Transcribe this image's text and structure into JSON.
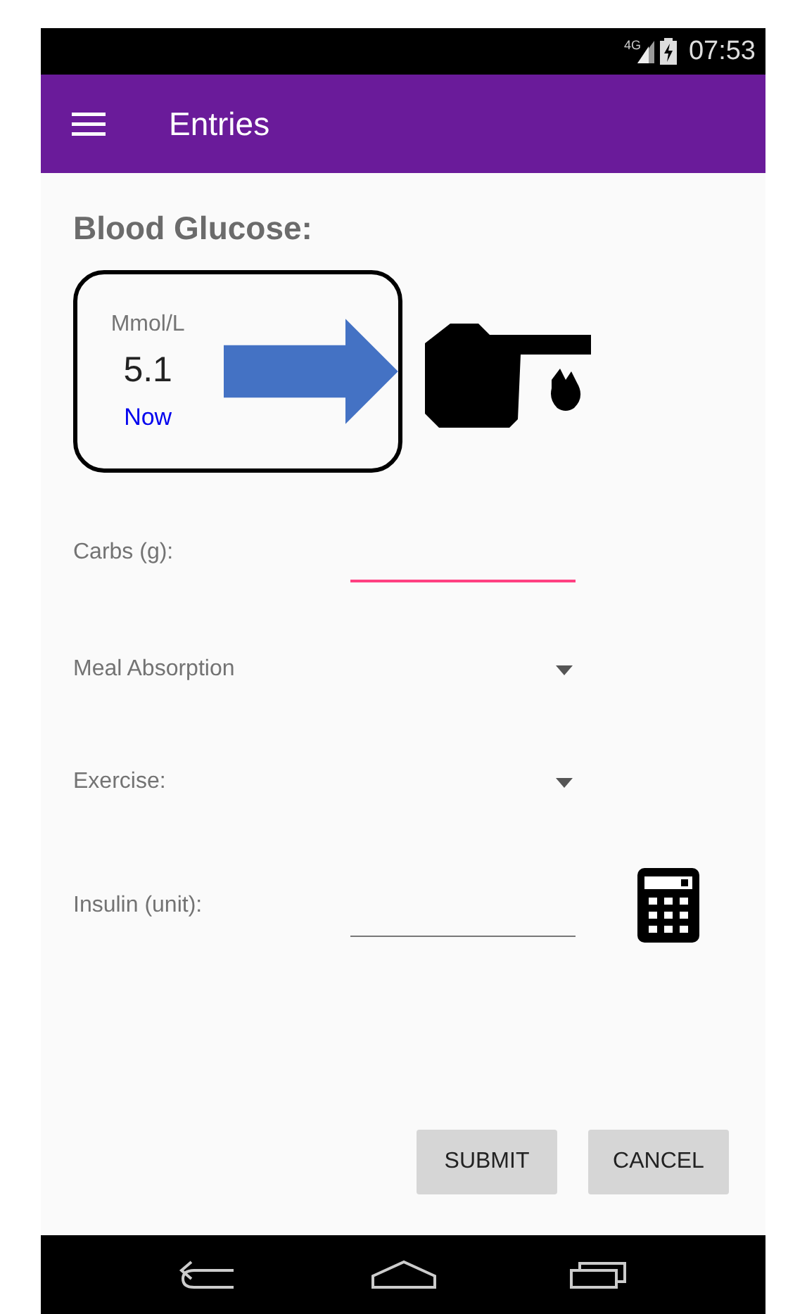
{
  "status_bar": {
    "network": "4G",
    "time": "07:53"
  },
  "app_bar": {
    "title": "Entries"
  },
  "section_title": "Blood Glucose:",
  "glucose": {
    "unit": "Mmol/L",
    "value": "5.1",
    "time": "Now"
  },
  "fields": [
    {
      "kind": "input",
      "label": "Carbs (g):",
      "focused": true
    },
    {
      "kind": "dropdown",
      "label": "Meal Absorption"
    },
    {
      "kind": "dropdown",
      "label": "Exercise:"
    },
    {
      "kind": "calculator",
      "label": "Insulin (unit):",
      "focused": false
    }
  ],
  "buttons": [
    "SUBMIT",
    "CANCEL"
  ]
}
